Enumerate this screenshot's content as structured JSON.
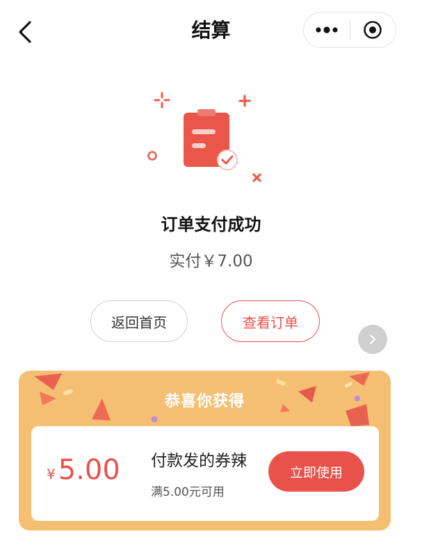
{
  "nav": {
    "title": "结算",
    "back_icon": "chevron-left-icon",
    "more_icon": "more-dots-icon",
    "close_icon": "target-circle-icon"
  },
  "result": {
    "title": "订单支付成功",
    "paid_text": "实付￥7.00",
    "illustration_icon": "clipboard-check-icon"
  },
  "actions": {
    "home_label": "返回首页",
    "view_order_label": "查看订单"
  },
  "float_button": {
    "icon": "chevron-right-icon"
  },
  "coupon_card": {
    "heading": "恭喜你获得",
    "currency": "¥",
    "amount": "5.00",
    "name": "付款发的券辣",
    "condition": "满5.00元可用",
    "use_label": "立即使用"
  },
  "colors": {
    "accent": "#e9524a",
    "card_bg": "#f5bf73",
    "float_btn": "#cfcfcf"
  }
}
